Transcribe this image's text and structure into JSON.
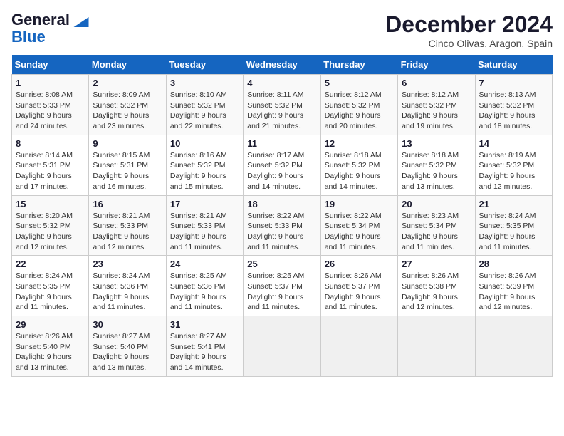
{
  "logo": {
    "line1": "General",
    "line2": "Blue"
  },
  "title": "December 2024",
  "location": "Cinco Olivas, Aragon, Spain",
  "days_of_week": [
    "Sunday",
    "Monday",
    "Tuesday",
    "Wednesday",
    "Thursday",
    "Friday",
    "Saturday"
  ],
  "weeks": [
    [
      {
        "day": 1,
        "sunrise": "8:08 AM",
        "sunset": "5:33 PM",
        "daylight": "9 hours and 24 minutes."
      },
      {
        "day": 2,
        "sunrise": "8:09 AM",
        "sunset": "5:32 PM",
        "daylight": "9 hours and 23 minutes."
      },
      {
        "day": 3,
        "sunrise": "8:10 AM",
        "sunset": "5:32 PM",
        "daylight": "9 hours and 22 minutes."
      },
      {
        "day": 4,
        "sunrise": "8:11 AM",
        "sunset": "5:32 PM",
        "daylight": "9 hours and 21 minutes."
      },
      {
        "day": 5,
        "sunrise": "8:12 AM",
        "sunset": "5:32 PM",
        "daylight": "9 hours and 20 minutes."
      },
      {
        "day": 6,
        "sunrise": "8:12 AM",
        "sunset": "5:32 PM",
        "daylight": "9 hours and 19 minutes."
      },
      {
        "day": 7,
        "sunrise": "8:13 AM",
        "sunset": "5:32 PM",
        "daylight": "9 hours and 18 minutes."
      }
    ],
    [
      {
        "day": 8,
        "sunrise": "8:14 AM",
        "sunset": "5:31 PM",
        "daylight": "9 hours and 17 minutes."
      },
      {
        "day": 9,
        "sunrise": "8:15 AM",
        "sunset": "5:31 PM",
        "daylight": "9 hours and 16 minutes."
      },
      {
        "day": 10,
        "sunrise": "8:16 AM",
        "sunset": "5:32 PM",
        "daylight": "9 hours and 15 minutes."
      },
      {
        "day": 11,
        "sunrise": "8:17 AM",
        "sunset": "5:32 PM",
        "daylight": "9 hours and 14 minutes."
      },
      {
        "day": 12,
        "sunrise": "8:18 AM",
        "sunset": "5:32 PM",
        "daylight": "9 hours and 14 minutes."
      },
      {
        "day": 13,
        "sunrise": "8:18 AM",
        "sunset": "5:32 PM",
        "daylight": "9 hours and 13 minutes."
      },
      {
        "day": 14,
        "sunrise": "8:19 AM",
        "sunset": "5:32 PM",
        "daylight": "9 hours and 12 minutes."
      }
    ],
    [
      {
        "day": 15,
        "sunrise": "8:20 AM",
        "sunset": "5:32 PM",
        "daylight": "9 hours and 12 minutes."
      },
      {
        "day": 16,
        "sunrise": "8:21 AM",
        "sunset": "5:33 PM",
        "daylight": "9 hours and 12 minutes."
      },
      {
        "day": 17,
        "sunrise": "8:21 AM",
        "sunset": "5:33 PM",
        "daylight": "9 hours and 11 minutes."
      },
      {
        "day": 18,
        "sunrise": "8:22 AM",
        "sunset": "5:33 PM",
        "daylight": "9 hours and 11 minutes."
      },
      {
        "day": 19,
        "sunrise": "8:22 AM",
        "sunset": "5:34 PM",
        "daylight": "9 hours and 11 minutes."
      },
      {
        "day": 20,
        "sunrise": "8:23 AM",
        "sunset": "5:34 PM",
        "daylight": "9 hours and 11 minutes."
      },
      {
        "day": 21,
        "sunrise": "8:24 AM",
        "sunset": "5:35 PM",
        "daylight": "9 hours and 11 minutes."
      }
    ],
    [
      {
        "day": 22,
        "sunrise": "8:24 AM",
        "sunset": "5:35 PM",
        "daylight": "9 hours and 11 minutes."
      },
      {
        "day": 23,
        "sunrise": "8:24 AM",
        "sunset": "5:36 PM",
        "daylight": "9 hours and 11 minutes."
      },
      {
        "day": 24,
        "sunrise": "8:25 AM",
        "sunset": "5:36 PM",
        "daylight": "9 hours and 11 minutes."
      },
      {
        "day": 25,
        "sunrise": "8:25 AM",
        "sunset": "5:37 PM",
        "daylight": "9 hours and 11 minutes."
      },
      {
        "day": 26,
        "sunrise": "8:26 AM",
        "sunset": "5:37 PM",
        "daylight": "9 hours and 11 minutes."
      },
      {
        "day": 27,
        "sunrise": "8:26 AM",
        "sunset": "5:38 PM",
        "daylight": "9 hours and 12 minutes."
      },
      {
        "day": 28,
        "sunrise": "8:26 AM",
        "sunset": "5:39 PM",
        "daylight": "9 hours and 12 minutes."
      }
    ],
    [
      {
        "day": 29,
        "sunrise": "8:26 AM",
        "sunset": "5:40 PM",
        "daylight": "9 hours and 13 minutes."
      },
      {
        "day": 30,
        "sunrise": "8:27 AM",
        "sunset": "5:40 PM",
        "daylight": "9 hours and 13 minutes."
      },
      {
        "day": 31,
        "sunrise": "8:27 AM",
        "sunset": "5:41 PM",
        "daylight": "9 hours and 14 minutes."
      },
      null,
      null,
      null,
      null
    ]
  ],
  "labels": {
    "sunrise": "Sunrise: ",
    "sunset": "Sunset: ",
    "daylight": "Daylight: "
  }
}
